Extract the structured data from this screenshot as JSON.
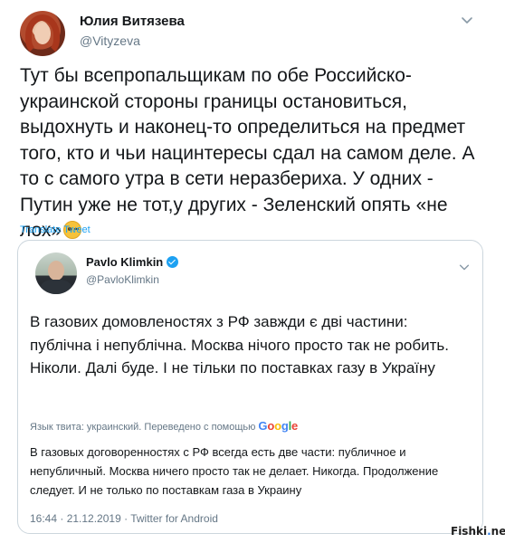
{
  "tweet": {
    "author_name": "Юлия Витязева",
    "author_handle": "@Vityzeva",
    "text": "Тут бы всепропальщикам по обе Российско-украинской стороны границы остановиться, выдохнуть и наконец-то определиться на предмет того, кто и чьи нацинтересы сдал на самом деле. А то с самого утра в сети неразбериха. У одних - Путин уже не тот,у других - Зеленский опять «не лох»",
    "translate_label": "Translate Tweet"
  },
  "quoted": {
    "author_name": "Pavlo Klimkin",
    "author_handle": "@PavloKlimkin",
    "text": "В газових домовленостях з РФ завжди є дві частини: публічна і непублічна. Москва нічого просто так не робить. Ніколи. Далі буде. І не тільки по поставках газу в Україну",
    "translation_label": "Язык твита: украинский. Переведено с помощью",
    "translation_provider": "Google",
    "translated_text": "В газовых договоренностях с РФ всегда есть две части: публичное и непубличный. Москва ничего просто так не делает. Никогда. Продолжение следует. И не только по поставкам газа в Украину",
    "timestamp": "16:44 · 21.12.2019 · Twitter for Android"
  },
  "watermark": {
    "part1": "Fishki",
    "dot": ".",
    "part2": "net"
  },
  "icons": {
    "author_avatar": "avatar-photo",
    "more": "chevron-down-icon",
    "verified": "verified-badge-icon",
    "emoji": "winking-face-emoji"
  },
  "colors": {
    "link": "#1da1f2",
    "secondary_text": "#657786",
    "border": "#ccd6dd"
  }
}
